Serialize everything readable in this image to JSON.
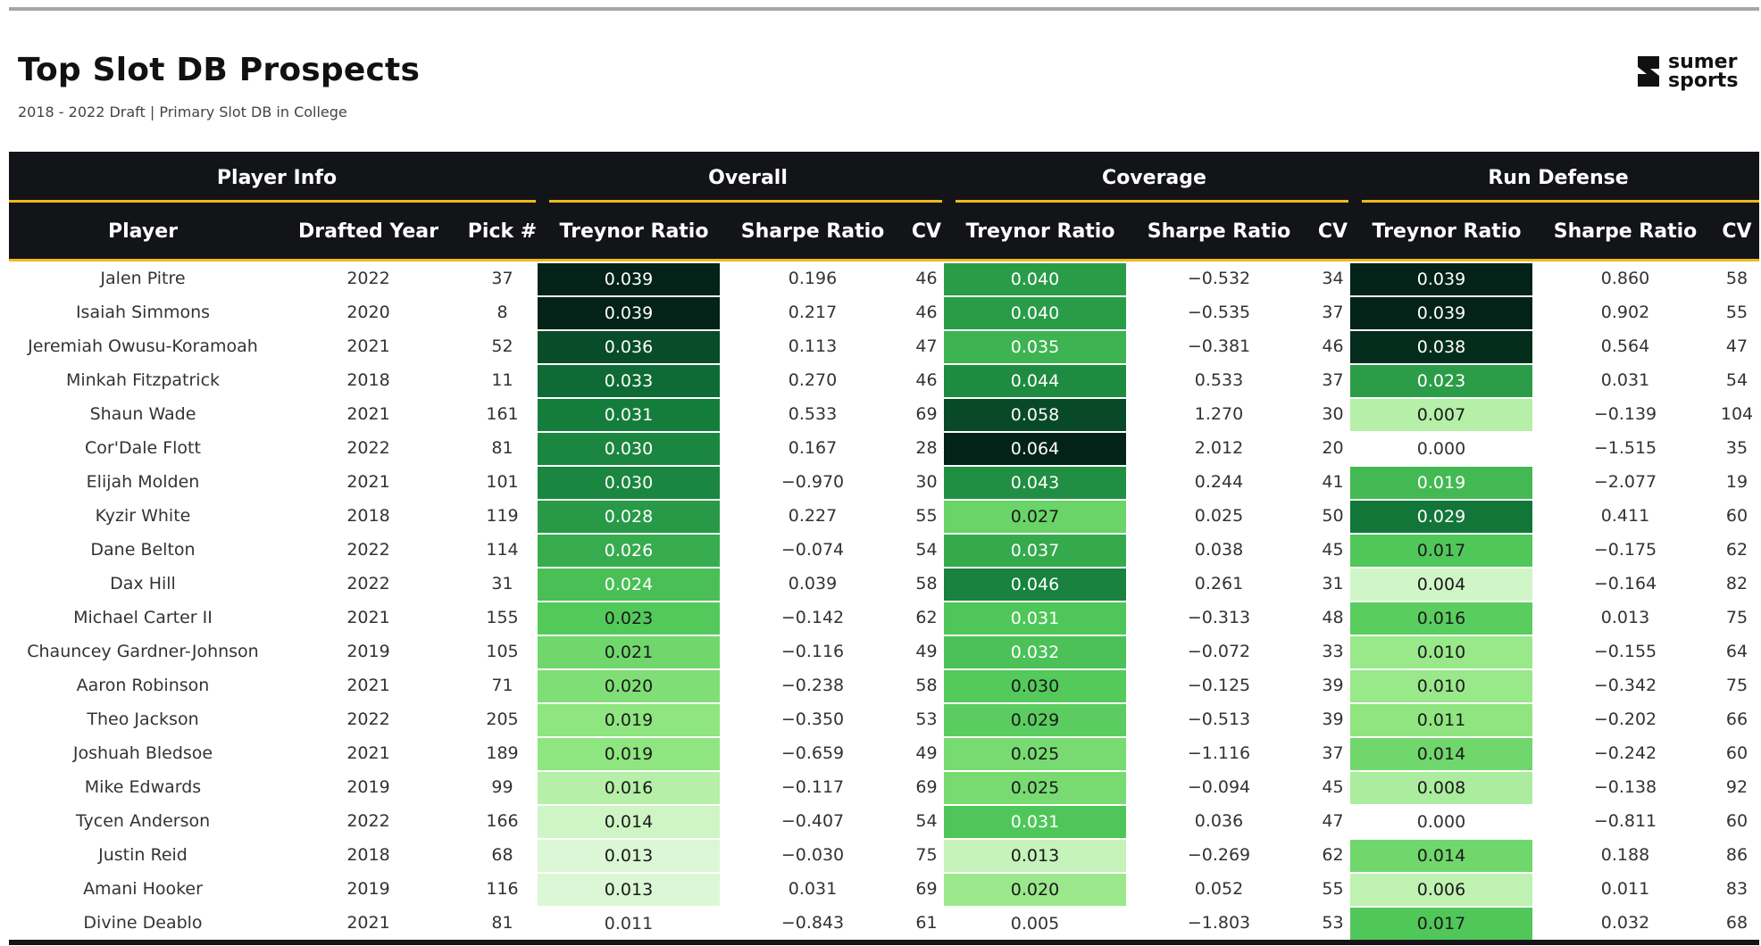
{
  "header": {
    "title": "Top Slot DB Prospects",
    "subtitle": "2018 - 2022 Draft | Primary Slot DB in College",
    "logo_line1": "sumer",
    "logo_line2": "sports"
  },
  "colors": {
    "header_bg": "#131418",
    "accent": "#f0b81c",
    "heat_low": "#f4fcf3",
    "heat_high": "#032218"
  },
  "chart_data": {
    "type": "table",
    "groups": [
      "Player Info",
      "Overall",
      "Coverage",
      "Run Defense"
    ],
    "columns": [
      "Player",
      "Drafted Year",
      "Pick #",
      "Treynor Ratio",
      "Sharpe Ratio",
      "CV",
      "Treynor Ratio",
      "Sharpe Ratio",
      "CV",
      "Treynor Ratio",
      "Sharpe Ratio",
      "CV"
    ],
    "heat_columns": [
      3,
      6,
      9
    ],
    "rows": [
      [
        "Jalen Pitre",
        "2022",
        "37",
        "0.039",
        "0.196",
        "46",
        "0.040",
        "−0.532",
        "34",
        "0.039",
        "0.860",
        "58"
      ],
      [
        "Isaiah Simmons",
        "2020",
        "8",
        "0.039",
        "0.217",
        "46",
        "0.040",
        "−0.535",
        "37",
        "0.039",
        "0.902",
        "55"
      ],
      [
        "Jeremiah Owusu-Koramoah",
        "2021",
        "52",
        "0.036",
        "0.113",
        "47",
        "0.035",
        "−0.381",
        "46",
        "0.038",
        "0.564",
        "47"
      ],
      [
        "Minkah Fitzpatrick",
        "2018",
        "11",
        "0.033",
        "0.270",
        "46",
        "0.044",
        "0.533",
        "37",
        "0.023",
        "0.031",
        "54"
      ],
      [
        "Shaun Wade",
        "2021",
        "161",
        "0.031",
        "0.533",
        "69",
        "0.058",
        "1.270",
        "30",
        "0.007",
        "−0.139",
        "104"
      ],
      [
        "Cor'Dale Flott",
        "2022",
        "81",
        "0.030",
        "0.167",
        "28",
        "0.064",
        "2.012",
        "20",
        "0.000",
        "−1.515",
        "35"
      ],
      [
        "Elijah Molden",
        "2021",
        "101",
        "0.030",
        "−0.970",
        "30",
        "0.043",
        "0.244",
        "41",
        "0.019",
        "−2.077",
        "19"
      ],
      [
        "Kyzir White",
        "2018",
        "119",
        "0.028",
        "0.227",
        "55",
        "0.027",
        "0.025",
        "50",
        "0.029",
        "0.411",
        "60"
      ],
      [
        "Dane Belton",
        "2022",
        "114",
        "0.026",
        "−0.074",
        "54",
        "0.037",
        "0.038",
        "45",
        "0.017",
        "−0.175",
        "62"
      ],
      [
        "Dax Hill",
        "2022",
        "31",
        "0.024",
        "0.039",
        "58",
        "0.046",
        "0.261",
        "31",
        "0.004",
        "−0.164",
        "82"
      ],
      [
        "Michael Carter II",
        "2021",
        "155",
        "0.023",
        "−0.142",
        "62",
        "0.031",
        "−0.313",
        "48",
        "0.016",
        "0.013",
        "75"
      ],
      [
        "Chauncey Gardner-Johnson",
        "2019",
        "105",
        "0.021",
        "−0.116",
        "49",
        "0.032",
        "−0.072",
        "33",
        "0.010",
        "−0.155",
        "64"
      ],
      [
        "Aaron Robinson",
        "2021",
        "71",
        "0.020",
        "−0.238",
        "58",
        "0.030",
        "−0.125",
        "39",
        "0.010",
        "−0.342",
        "75"
      ],
      [
        "Theo Jackson",
        "2022",
        "205",
        "0.019",
        "−0.350",
        "53",
        "0.029",
        "−0.513",
        "39",
        "0.011",
        "−0.202",
        "66"
      ],
      [
        "Joshuah Bledsoe",
        "2021",
        "189",
        "0.019",
        "−0.659",
        "49",
        "0.025",
        "−1.116",
        "37",
        "0.014",
        "−0.242",
        "60"
      ],
      [
        "Mike Edwards",
        "2019",
        "99",
        "0.016",
        "−0.117",
        "69",
        "0.025",
        "−0.094",
        "45",
        "0.008",
        "−0.138",
        "92"
      ],
      [
        "Tycen Anderson",
        "2022",
        "166",
        "0.014",
        "−0.407",
        "54",
        "0.031",
        "0.036",
        "47",
        "0.000",
        "−0.811",
        "60"
      ],
      [
        "Justin Reid",
        "2018",
        "68",
        "0.013",
        "−0.030",
        "75",
        "0.013",
        "−0.269",
        "62",
        "0.014",
        "0.188",
        "86"
      ],
      [
        "Amani Hooker",
        "2019",
        "116",
        "0.013",
        "0.031",
        "69",
        "0.020",
        "0.052",
        "55",
        "0.006",
        "0.011",
        "83"
      ],
      [
        "Divine Deablo",
        "2021",
        "81",
        "0.011",
        "−0.843",
        "61",
        "0.005",
        "−1.803",
        "53",
        "0.017",
        "0.032",
        "68"
      ]
    ]
  }
}
